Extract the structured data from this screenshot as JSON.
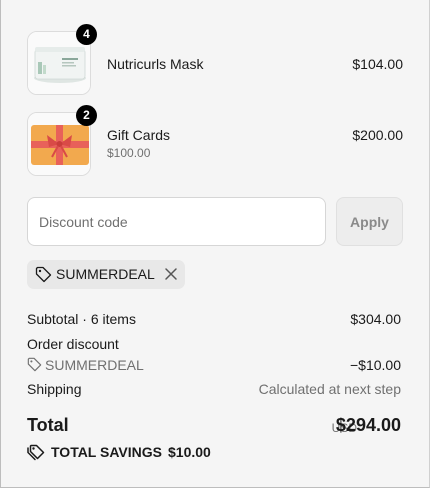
{
  "items": [
    {
      "name": "Nutricurls Mask",
      "subtitle": "",
      "price": "$104.00",
      "quantity": "4",
      "image": "nutricurls-mask-jar"
    },
    {
      "name": "Gift Cards",
      "subtitle": "$100.00",
      "price": "$200.00",
      "quantity": "2",
      "image": "gift-card"
    }
  ],
  "discount": {
    "placeholder": "Discount code",
    "value": "",
    "apply_label": "Apply",
    "applied_code": "SUMMERDEAL"
  },
  "summary": {
    "subtotal_label": "Subtotal · 6 items",
    "subtotal_value": "$304.00",
    "order_discount_label": "Order discount",
    "discount_code": "SUMMERDEAL",
    "discount_value": "−$10.00",
    "shipping_label": "Shipping",
    "shipping_value": "Calculated at next step",
    "total_label": "Total",
    "currency": "USD",
    "total_value": "$294.00",
    "savings_label": "TOTAL SAVINGS",
    "savings_value": "$10.00"
  },
  "icons": {
    "tag": "tag-icon",
    "remove": "close-icon",
    "savings": "tags-icon"
  },
  "colors": {
    "background": "#f5f5f5",
    "badge": "#000000",
    "muted": "#707070",
    "chip": "#e8e8e8",
    "gift_card": "#f2a94e",
    "ribbon": "#e8615a"
  }
}
